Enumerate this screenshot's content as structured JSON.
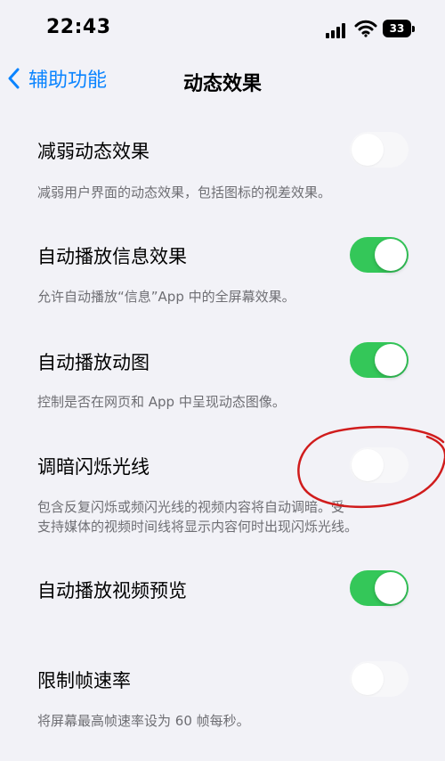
{
  "status_bar": {
    "time": "22:43",
    "battery": "33",
    "icons": [
      "cellular-signal-icon",
      "wifi-icon",
      "battery-icon"
    ]
  },
  "nav": {
    "back_label": "辅助功能",
    "title": "动态效果"
  },
  "settings": [
    {
      "label": "减弱动态效果",
      "on": false,
      "description": "减弱用户界面的动态效果，包括图标的视差效果。"
    },
    {
      "label": "自动播放信息效果",
      "on": true,
      "description": "允许自动播放“信息”App 中的全屏幕效果。"
    },
    {
      "label": "自动播放动图",
      "on": true,
      "description": "控制是否在网页和 App 中呈现动态图像。"
    },
    {
      "label": "调暗闪烁光线",
      "on": false,
      "description_line1": "包含反复闪烁或频闪光线的视频内容将自动调暗。受",
      "description_line2": "支持媒体的视频时间线将显示内容何时出现闪烁光线。"
    },
    {
      "label": "自动播放视频预览",
      "on": true
    },
    {
      "label": "限制帧速率",
      "on": false,
      "description": "将屏幕最高帧速率设为 60 帧每秒。"
    }
  ],
  "colors": {
    "background": "#f2f2f7",
    "accent": "#0a84ff",
    "toggle_on": "#34c759",
    "description_text": "#6e6e73",
    "annotation": "#d01c1c"
  }
}
